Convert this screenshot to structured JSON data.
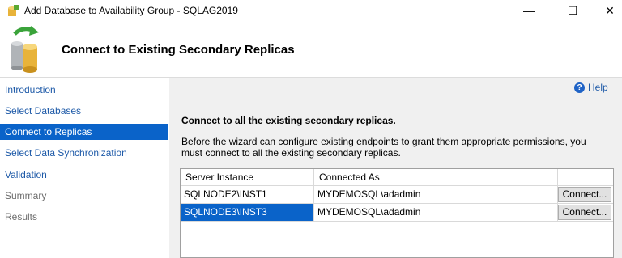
{
  "window": {
    "title": "Add Database to Availability Group - SQLAG2019",
    "minimize": "—",
    "maximize": "☐",
    "close": "✕"
  },
  "header": {
    "title": "Connect to Existing Secondary Replicas",
    "icon": "database-sync-icon"
  },
  "sidebar": {
    "items": [
      {
        "label": "Introduction",
        "state": "link"
      },
      {
        "label": "Select Databases",
        "state": "link"
      },
      {
        "label": "Connect to Replicas",
        "state": "active"
      },
      {
        "label": "Select Data Synchronization",
        "state": "link"
      },
      {
        "label": "Validation",
        "state": "link"
      },
      {
        "label": "Summary",
        "state": "disabled"
      },
      {
        "label": "Results",
        "state": "disabled"
      }
    ]
  },
  "main": {
    "help_label": "Help",
    "section_title": "Connect to all the existing secondary replicas.",
    "description": "Before the wizard can configure existing endpoints to grant them appropriate permissions, you must connect to all the existing secondary replicas.",
    "grid": {
      "columns": [
        "Server Instance",
        "Connected As",
        ""
      ],
      "rows": [
        {
          "server": "SQLNODE2\\INST1",
          "connected_as": "MYDEMOSQL\\adadmin",
          "button": "Connect...",
          "selected": false
        },
        {
          "server": "SQLNODE3\\INST3",
          "connected_as": "MYDEMOSQL\\adadmin",
          "button": "Connect...",
          "selected": true
        }
      ]
    }
  },
  "colors": {
    "accent": "#0a63c9",
    "link": "#1e5aa8",
    "panel_bg": "#f0f0f0"
  }
}
